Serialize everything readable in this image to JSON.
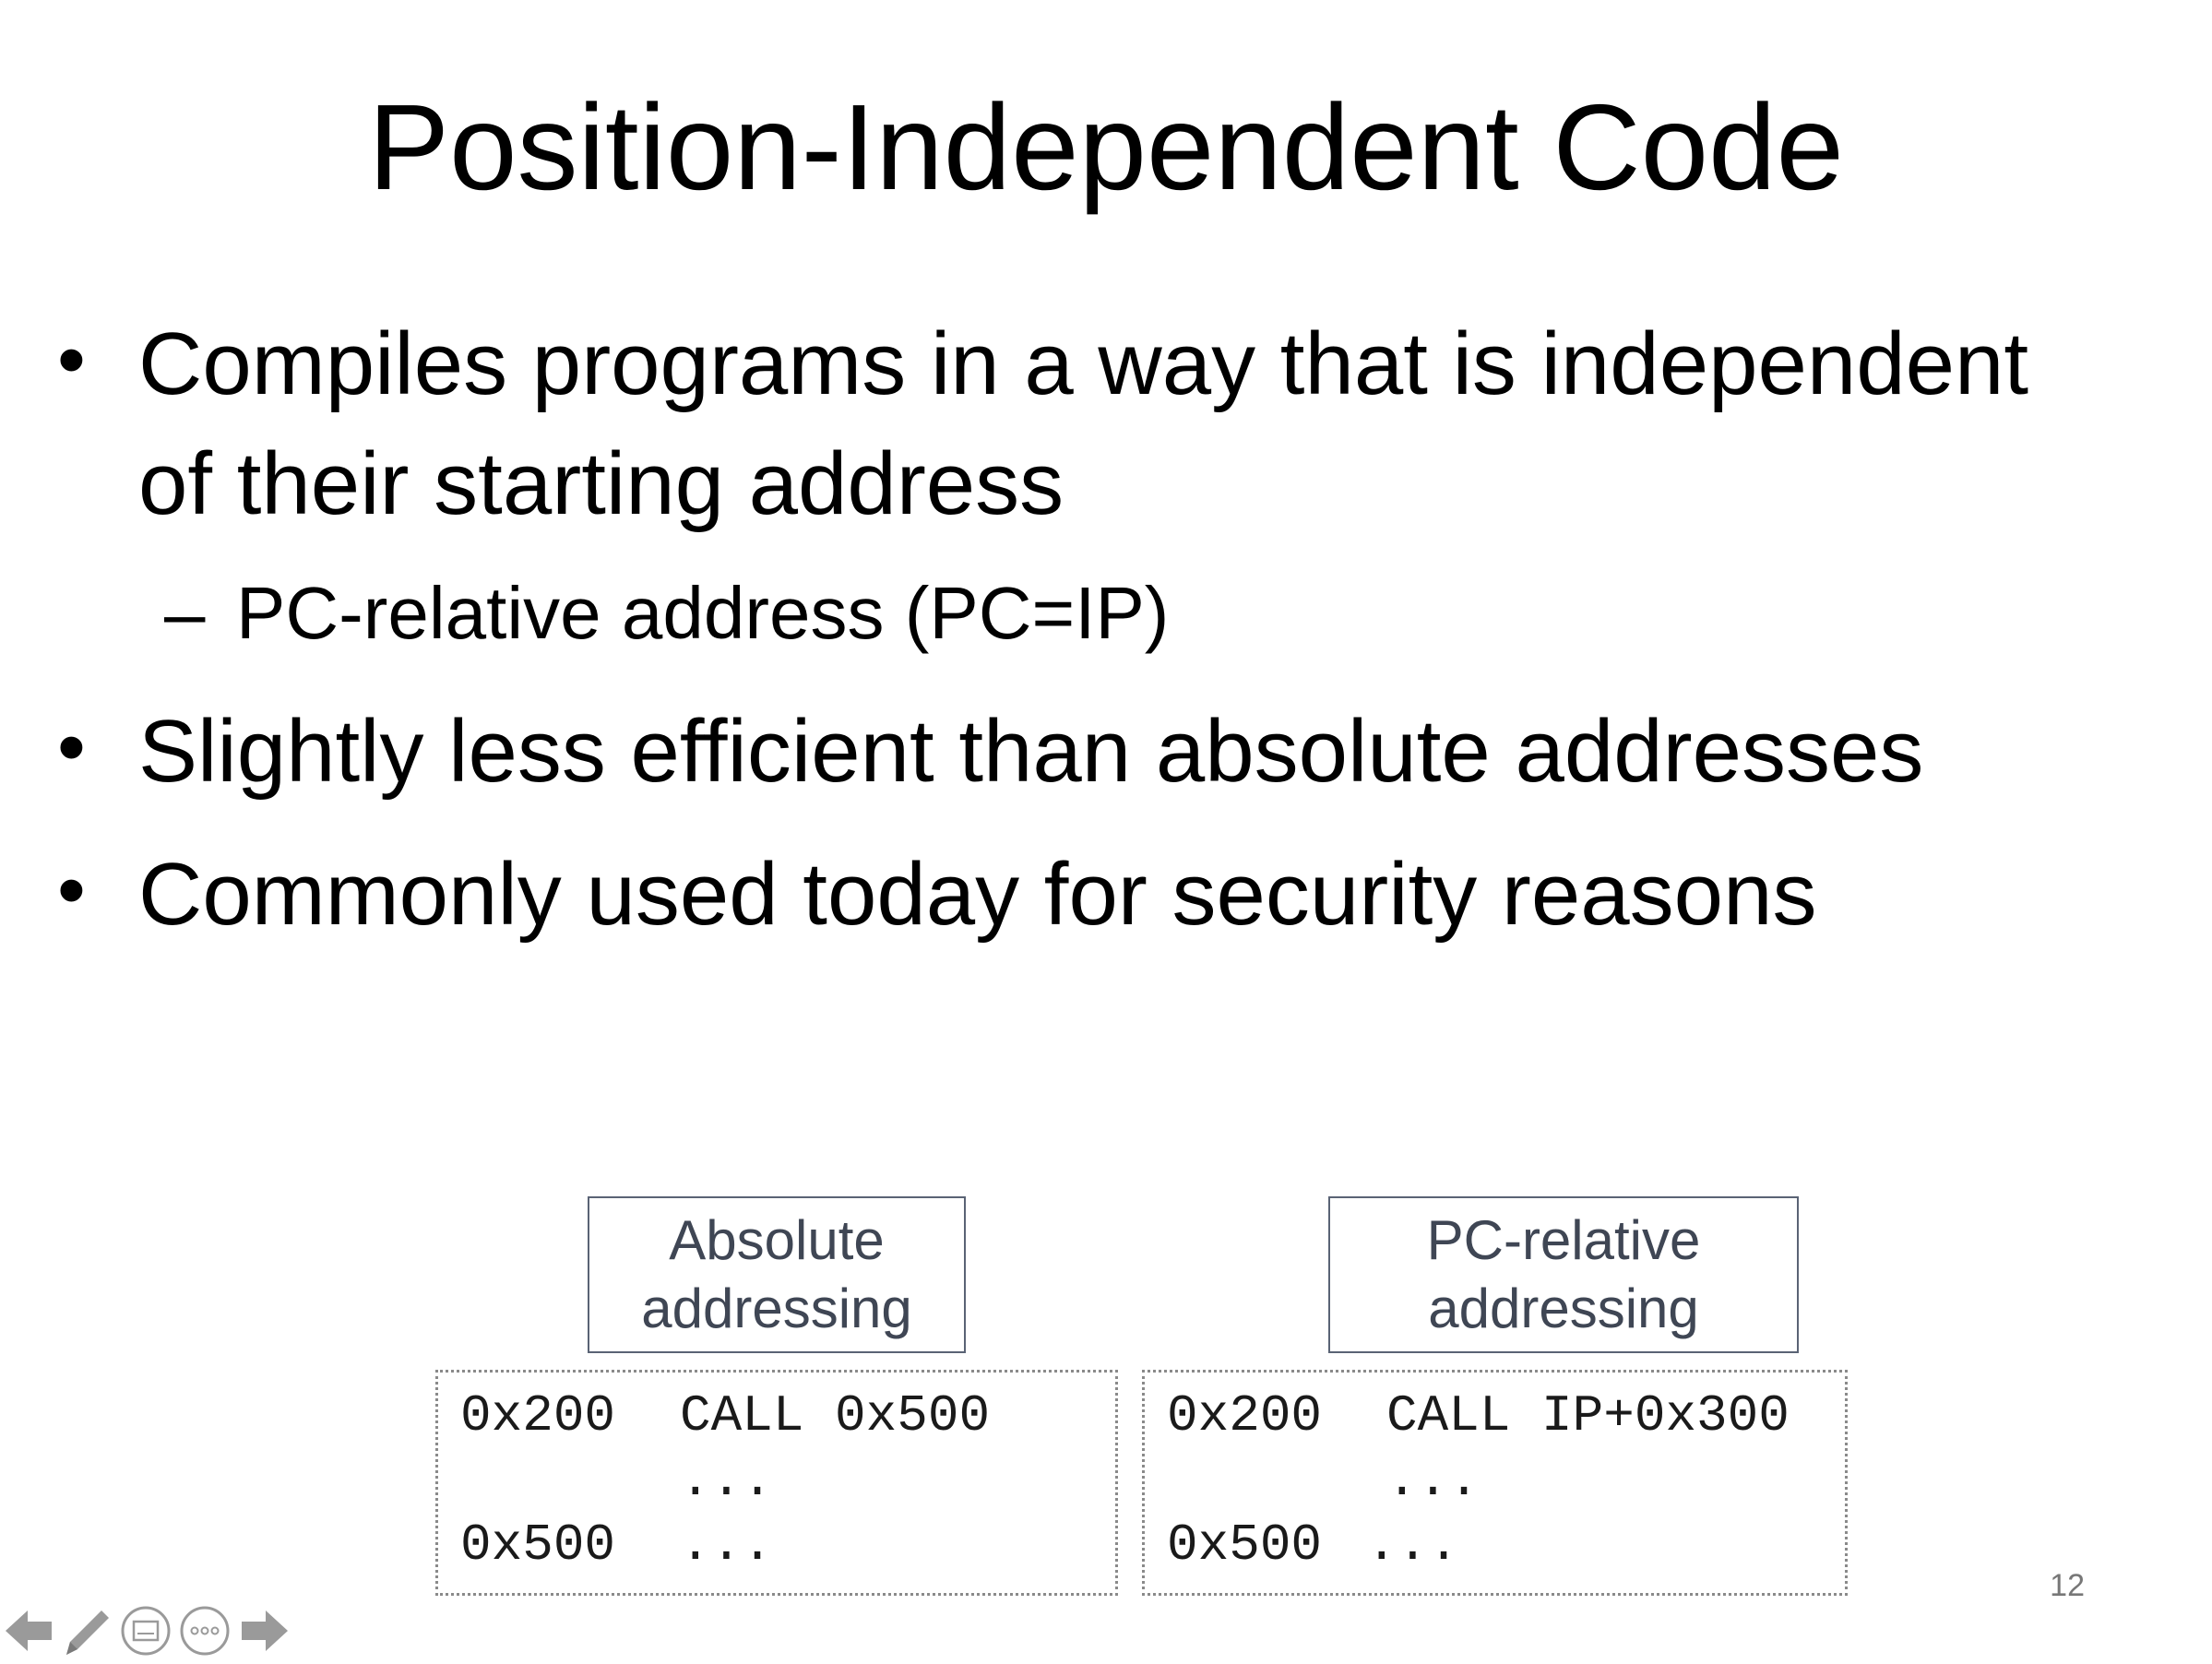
{
  "slide": {
    "title": "Position-Independent Code",
    "bullets": [
      {
        "dot": "•",
        "lines": [
          "Compiles programs in a way that is independent",
          "of their starting address"
        ],
        "sub": {
          "dash": "–",
          "text": "PC-relative address (PC=IP)"
        }
      },
      {
        "dot": "•",
        "lines": [
          "Slightly less efficient than absolute addresses"
        ]
      },
      {
        "dot": "•",
        "lines": [
          "Commonly used today for security reasons"
        ]
      }
    ],
    "page_number": "12"
  },
  "diagram": {
    "absolute": {
      "label_lines": [
        "Absolute",
        "addressing"
      ],
      "code": {
        "row1_addr": "0x200",
        "row1_instr": "CALL 0x500",
        "row2_instr": "...",
        "row3_addr": "0x500",
        "row3_instr": "..."
      }
    },
    "relative": {
      "label_lines": [
        "PC-relative",
        "addressing"
      ],
      "code": {
        "row1_addr": "0x200",
        "row1_instr": "CALL IP+0x300",
        "row2_instr": "...",
        "row3_addr": "0x500",
        "row3_instr": "..."
      }
    }
  },
  "nav": {
    "icons": [
      "arrow-left-icon",
      "pen-icon",
      "slides-icon",
      "more-icon",
      "arrow-right-icon"
    ],
    "icon_color": "#9a9a9a"
  }
}
